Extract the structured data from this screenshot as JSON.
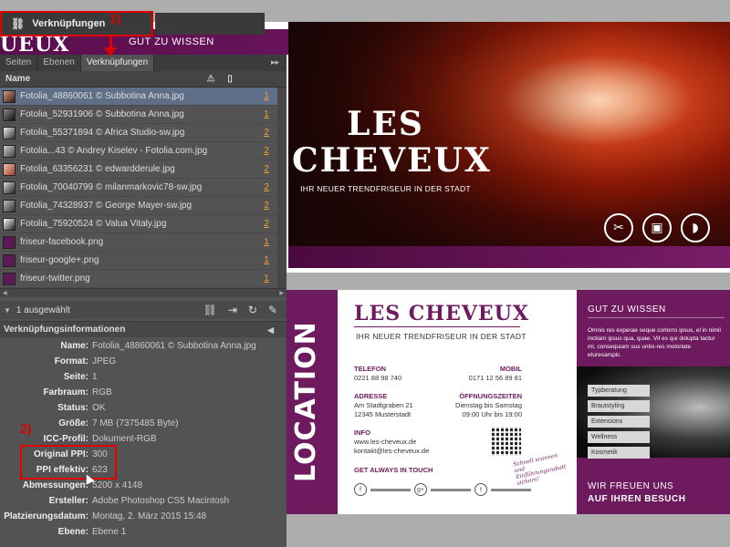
{
  "panel": {
    "title": "Verknüpfungen",
    "annotation_1": "1)",
    "annotation_2": "2)",
    "tabs": [
      {
        "label": "Seiten"
      },
      {
        "label": "Ebenen"
      },
      {
        "label": "Verknüpfungen"
      }
    ],
    "tab_menu": "▸▸",
    "columns": {
      "name": "Name",
      "status_icon": "warning-icon",
      "page_icon": "page-icon"
    },
    "links": [
      {
        "name": "Fotolia_48860061 © Subbotina Anna.jpg",
        "page": "1",
        "selected": true
      },
      {
        "name": "Fotolia_52931906 © Subbotina Anna.jpg",
        "page": "1",
        "selected": false
      },
      {
        "name": "Fotolia_55371894 © Africa Studio-sw.jpg",
        "page": "2",
        "selected": false
      },
      {
        "name": "Fotolia...43 © Andrey Kiselev - Fotolia.com.jpg",
        "page": "2",
        "selected": false
      },
      {
        "name": "Fotolia_63356231 © edwardderule.jpg",
        "page": "2",
        "selected": false
      },
      {
        "name": "Fotolia_70040799 © milanmarkovic78-sw.jpg",
        "page": "2",
        "selected": false
      },
      {
        "name": "Fotolia_74328937 © George Mayer-sw.jpg",
        "page": "2",
        "selected": false
      },
      {
        "name": "Fotolia_75920524 © Valua Vitaly.jpg",
        "page": "2",
        "selected": false
      },
      {
        "name": "friseur-facebook.png",
        "page": "1",
        "selected": false
      },
      {
        "name": "friseur-google+.png",
        "page": "1",
        "selected": false
      },
      {
        "name": "friseur-twitter.png",
        "page": "1",
        "selected": false
      }
    ],
    "selected_count": "1 ausgewählt",
    "info_title": "Verknüpfungsinformationen",
    "info": [
      {
        "key": "Name:",
        "value": "Fotolia_48860061 © Subbotina Anna.jpg"
      },
      {
        "key": "Format:",
        "value": "JPEG"
      },
      {
        "key": "Seite:",
        "value": "1"
      },
      {
        "key": "Farbraum:",
        "value": "RGB"
      },
      {
        "key": "Status:",
        "value": "OK"
      },
      {
        "key": "Größe:",
        "value": "7 MB (7375485 Byte)"
      },
      {
        "key": "ICC-Profil:",
        "value": "Dokument-RGB"
      },
      {
        "key": "Original PPI:",
        "value": "300"
      },
      {
        "key": "PPI effektiv:",
        "value": "623"
      },
      {
        "key": "Abmessungen:",
        "value": "5200 x 4148"
      },
      {
        "key": "Ersteller:",
        "value": "Adobe Photoshop CS5 Macintosh"
      },
      {
        "key": "Platzierungsdatum:",
        "value": "Montag, 2. März 2015 15:48"
      },
      {
        "key": "Ebene:",
        "value": "Ebene 1"
      }
    ]
  },
  "doc_top": {
    "logo_fragment": "UEUX",
    "band_text": "GUT ZU WISSEN",
    "hero_title_1": "LES",
    "hero_title_2": "CHEVEUX",
    "hero_sub": "IHR NEUER TRENDFRISEUR IN DER STADT",
    "icons": [
      "scissors-icon",
      "salon-icon",
      "hairdryer-icon"
    ]
  },
  "doc_bottom": {
    "location": "LOCATION",
    "title": "LES CHEVEUX",
    "subtitle": "IHR NEUER TRENDFRISEUR IN DER STADT",
    "telefon_label": "TELEFON",
    "telefon_value": "0221 88 98 740",
    "mobil_label": "MOBIL",
    "mobil_value": "0171 12 56 89 81",
    "adresse_label": "ADRESSE",
    "adresse_value": "Am Stadtgraben 21\n12345 Musterstadt",
    "zeiten_label": "ÖFFNUNGSZEITEN",
    "zeiten_value": "Dienstag bis Samstag\n09:00 Uhr bis 19:00",
    "info_label": "INFO",
    "info_value": "www.les-cheveux.de\nkontakt@les-cheveux.de",
    "touch": "GET ALWAYS IN TOUCH",
    "signature": "Schnell scannen und Einführungsrabatt sichern!",
    "gut_title": "GUT ZU WISSEN",
    "gut_text": "Omnis res experae seque corlorro ipsus, el in nimil inctiam ipsus qua, quae. Vit es qui dolupta tactur mi, consequiam sus untio-res moloriate eturesarspic.",
    "services": [
      "Typberatung",
      "Brautstyling",
      "Extensions",
      "Wellness",
      "Kosmetik"
    ],
    "footer_1": "WIR FREUEN UNS",
    "footer_2": "AUF IHREN BESUCH",
    "social": [
      "f",
      "g+",
      "t"
    ]
  },
  "colors": {
    "brand_purple": "#6d1a5e",
    "annotation_red": "#e00000",
    "link_orange": "#f0a030"
  }
}
